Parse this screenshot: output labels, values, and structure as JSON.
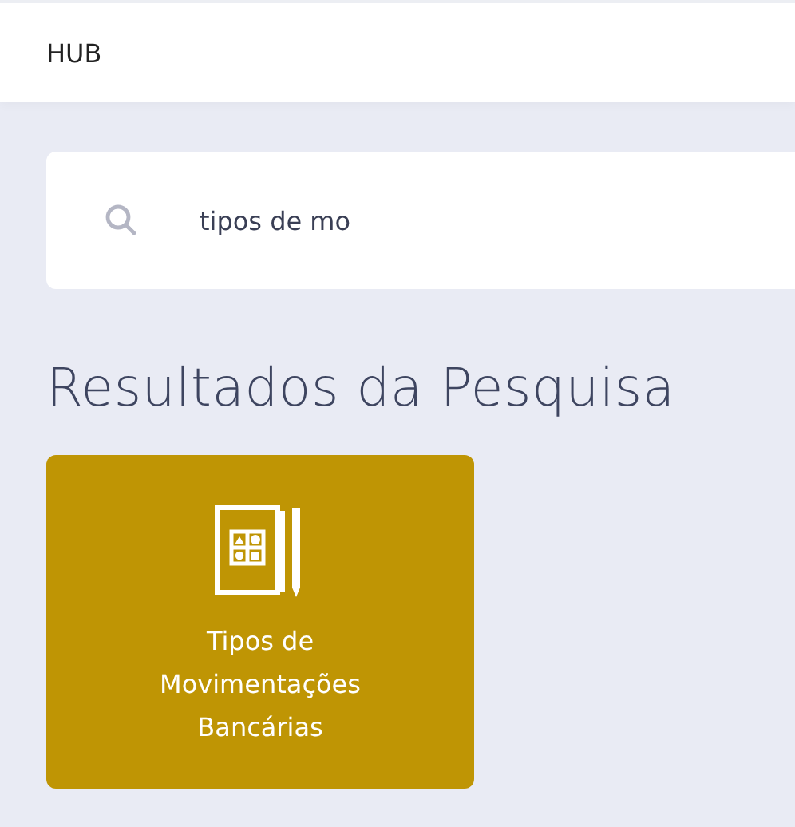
{
  "header": {
    "title": "HUB"
  },
  "search": {
    "value": "tipos de mo"
  },
  "results_heading": "Resultados da Pesquisa",
  "results": [
    {
      "label": "Tipos de Movimentações Bancárias"
    }
  ]
}
